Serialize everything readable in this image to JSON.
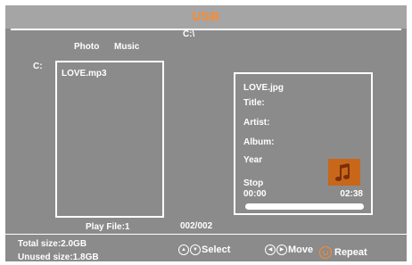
{
  "header": {
    "title": "USB"
  },
  "browser": {
    "path": "C:\\",
    "tabs": [
      "Photo",
      "Music"
    ],
    "drive_label": "C:",
    "files": [
      "LOVE.mp3"
    ]
  },
  "info_panel": {
    "filename": "LOVE.jpg",
    "title_label": "Title:",
    "artist_label": "Artist:",
    "album_label": "Album:",
    "year_label": "Year",
    "state": "Stop",
    "elapsed": "00:00",
    "duration": "02:38",
    "progress": 0,
    "thumbnail_icon": "music-note-icon",
    "thumbnail_color": "#c8671a"
  },
  "footer": {
    "play_file": "Play File:1",
    "page_count": "002/002",
    "total_size": "Total size:2.0GB",
    "unused_size": "Unused size:1.8GB",
    "hints": {
      "select": "Select",
      "move": "Move",
      "repeat": "Repeat"
    }
  },
  "colors": {
    "accent": "#ff8a2a",
    "panel_bg": "#8b8b8b",
    "header_bg": "#a5a5a5"
  }
}
